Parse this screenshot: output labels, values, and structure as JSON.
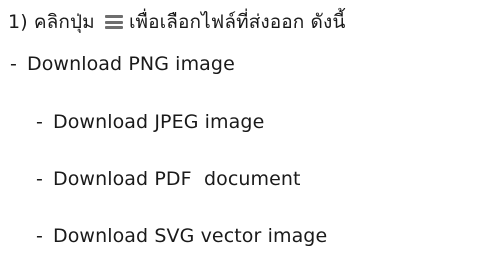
{
  "instruction": {
    "number": "1)",
    "before_icon": "คลิกปุ่ม",
    "icon": "hamburger-menu-icon",
    "after_icon": "เพื่อเลือกไฟล์ที่ส่งออก ดังนี้"
  },
  "bullet": "-",
  "options": [
    "Download PNG image",
    "Download JPEG image",
    "Download PDF  document",
    "Download SVG vector image"
  ]
}
